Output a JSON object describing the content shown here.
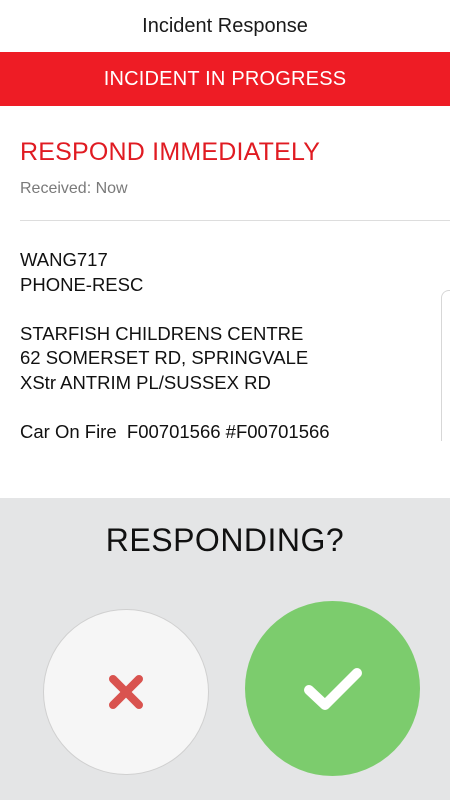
{
  "header": {
    "title": "Incident Response"
  },
  "banner": {
    "text": "INCIDENT IN PROGRESS",
    "color": "#ee1c25"
  },
  "incident": {
    "heading": "RESPOND IMMEDIATELY",
    "received": "Received: Now",
    "message_lines": [
      "WANG717",
      "PHONE-RESC",
      "",
      "STARFISH CHILDRENS CENTRE",
      "62 SOMERSET RD, SPRINGVALE",
      "XStr ANTRIM PL/SUSSEX RD",
      "",
      "Car On Fire  F00701566 #F00701566"
    ]
  },
  "response": {
    "prompt": "RESPONDING?",
    "decline_icon": "close-icon",
    "accept_icon": "check-icon",
    "decline_color": "#d9534f",
    "accept_color": "#7ccc6d"
  }
}
